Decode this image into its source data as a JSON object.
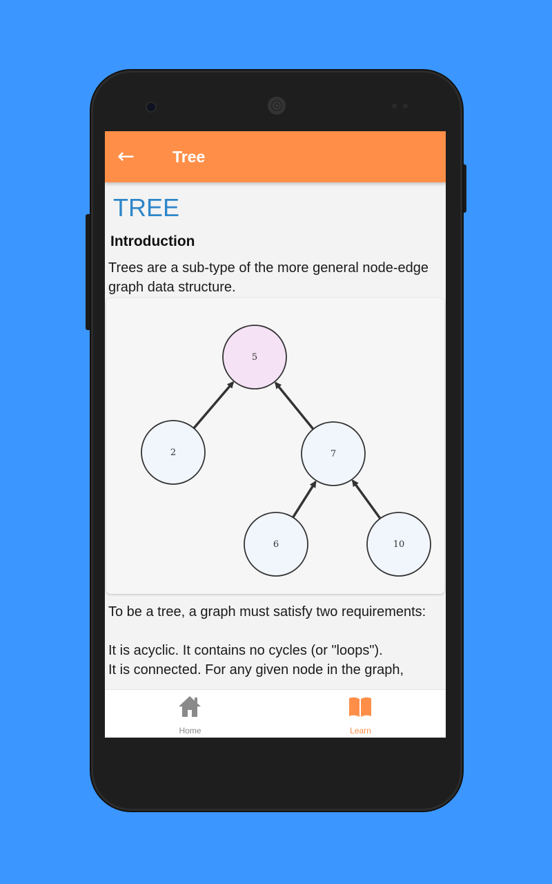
{
  "appbar": {
    "title": "Tree",
    "back_icon": "arrow-left-icon"
  },
  "content": {
    "heading": "TREE",
    "section_title": "Introduction",
    "intro_text": "Trees are a sub-type of the more general node-edge graph data structure.",
    "diagram": {
      "nodes": [
        {
          "id": "5",
          "label": "5",
          "highlight": true
        },
        {
          "id": "2",
          "label": "2",
          "highlight": false
        },
        {
          "id": "7",
          "label": "7",
          "highlight": false
        },
        {
          "id": "6",
          "label": "6",
          "highlight": false
        },
        {
          "id": "10",
          "label": "10",
          "highlight": false
        }
      ],
      "edges": [
        {
          "from": "2",
          "to": "5"
        },
        {
          "from": "7",
          "to": "5"
        },
        {
          "from": "6",
          "to": "7"
        },
        {
          "from": "10",
          "to": "7"
        }
      ],
      "colors": {
        "root_fill": "#f5e2f5",
        "node_fill": "#f1f6fd",
        "stroke": "#333333"
      }
    },
    "requirements_intro": "To be a tree, a graph must satisfy two requirements:",
    "requirement_1": "It is acyclic. It contains no cycles (or \"loops\").",
    "requirement_2": "It is connected. For any given node in the graph,"
  },
  "bottom_nav": {
    "items": [
      {
        "label": "Home",
        "icon": "home-icon",
        "active": false
      },
      {
        "label": "Learn",
        "icon": "book-open-icon",
        "active": true
      }
    ]
  },
  "colors": {
    "background": "#3b97ff",
    "appbar": "#ff8f48",
    "heading": "#2e86c9",
    "active_nav": "#ff8f48"
  }
}
